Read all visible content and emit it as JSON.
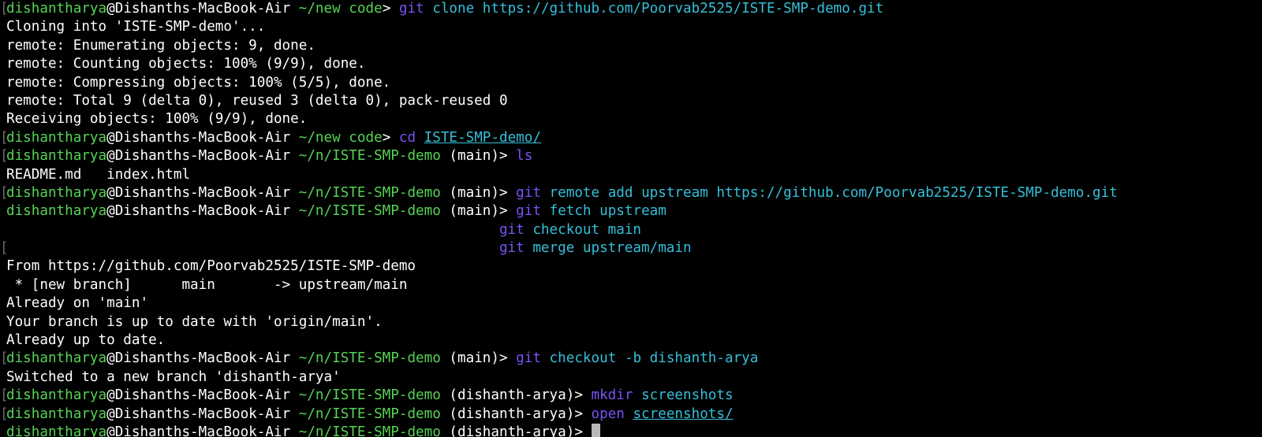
{
  "colors": {
    "background": "#000000",
    "prompt_user": "#55d355",
    "prompt_path": "#55d355",
    "command": "#7a52f5",
    "argument": "#35bfd9",
    "output": "#ffffff",
    "cursor": "#b8b8b8"
  },
  "prompt": {
    "user": "dishantharya",
    "host": "@Dishanths-MacBook-Air",
    "path_new_code": "~/new code",
    "path_repo": "~/n/ISTE-SMP-demo",
    "branch_main": "(main)",
    "branch_dishanth": "(dishanth-arya)",
    "symbol": ">"
  },
  "lines": {
    "l0": {
      "cmd": "git",
      "args": "clone https://github.com/Poorvab2525/ISTE-SMP-demo.git"
    },
    "l1": "Cloning into 'ISTE-SMP-demo'...",
    "l2": "remote: Enumerating objects: 9, done.",
    "l3": "remote: Counting objects: 100% (9/9), done.",
    "l4": "remote: Compressing objects: 100% (5/5), done.",
    "l5": "remote: Total 9 (delta 0), reused 3 (delta 0), pack-reused 0",
    "l6": "Receiving objects: 100% (9/9), done.",
    "l7": {
      "cmd": "cd",
      "link": "ISTE-SMP-demo/"
    },
    "l8": {
      "cmd": "ls"
    },
    "l9": "README.md   index.html",
    "l10": {
      "cmd": "git",
      "args": "remote add upstream https://github.com/Poorvab2525/ISTE-SMP-demo.git"
    },
    "l11": {
      "cmd": "git",
      "args": "fetch upstream"
    },
    "l12": {
      "cmd": "git",
      "args": "checkout main"
    },
    "l13": {
      "cmd": "git",
      "args": "merge upstream/main"
    },
    "l14": "From https://github.com/Poorvab2525/ISTE-SMP-demo",
    "l15": " * [new branch]      main       -> upstream/main",
    "l16": "Already on 'main'",
    "l17": "Your branch is up to date with 'origin/main'.",
    "l18": "Already up to date.",
    "l19": {
      "cmd": "git",
      "args": "checkout -b dishanth-arya"
    },
    "l20": "Switched to a new branch 'dishanth-arya'",
    "l21": {
      "cmd": "mkdir",
      "args": "screenshots"
    },
    "l22": {
      "cmd": "open",
      "link": "screenshots/"
    }
  }
}
